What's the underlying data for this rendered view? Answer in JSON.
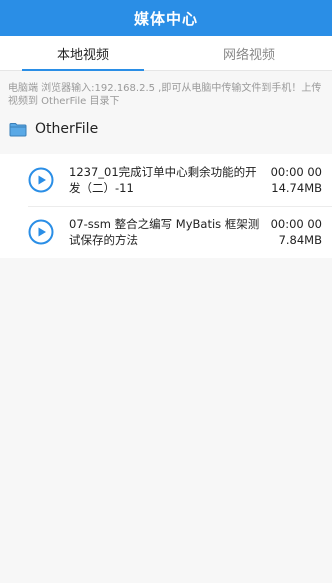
{
  "navbar": {
    "title": "媒体中心"
  },
  "tabs": [
    {
      "label": "本地视频",
      "active": true
    },
    {
      "label": "网络视频",
      "active": false
    }
  ],
  "hint": "电脑端 浏览器输入:192.168.2.5 ,即可从电脑中传输文件到手机！上传视频到 OtherFile 目录下",
  "folder": {
    "name": "OtherFile",
    "icon": "folder-icon"
  },
  "videos": [
    {
      "title": "1237_01完成订单中心剩余功能的开发（二）-11",
      "duration": "00:00 00",
      "size": "14.74MB",
      "icon": "play-circle-icon"
    },
    {
      "title": "07-ssm 整合之编写 MyBatis 框架测试保存的方法",
      "duration": "00:00 00",
      "size": "7.84MB",
      "icon": "play-circle-icon"
    }
  ],
  "colors": {
    "accent": "#2a8ee6",
    "background": "#f7f7f7"
  }
}
